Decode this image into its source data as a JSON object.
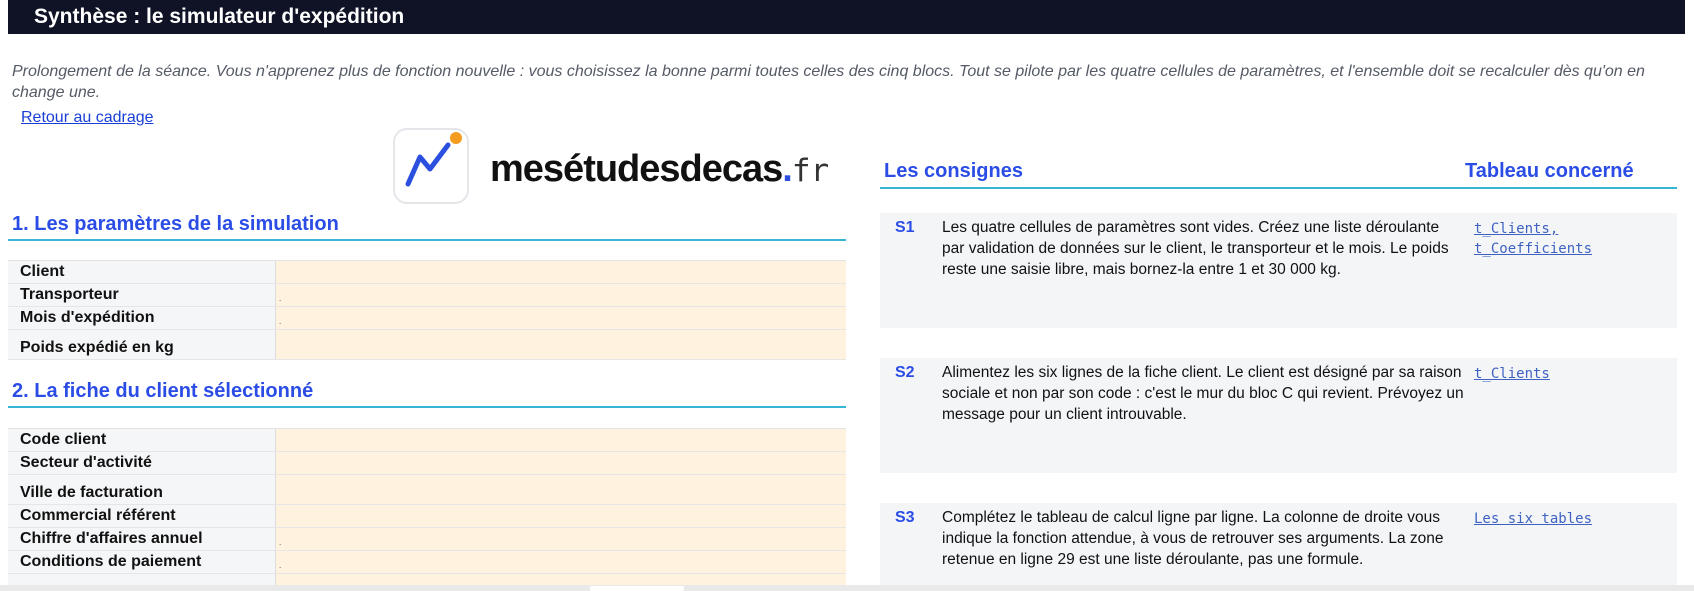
{
  "header": {
    "title": "Synthèse : le simulateur d'expédition"
  },
  "intro": {
    "text": "Prolongement de la séance. Vous n'apprenez plus de fonction nouvelle : vous choisissez la bonne parmi toutes celles des cinq blocs. Tout se pilote par les quatre cellules de paramètres, et l'ensemble doit se recalculer dès qu'on en change une.",
    "back_link": "Retour au cadrage"
  },
  "logo": {
    "brand": "mesétudesdecas",
    "dot": ".",
    "tld": "fr",
    "colors": {
      "mark": "#2b50e0",
      "accent": "#f39c1f"
    }
  },
  "section1": {
    "title": "1. Les paramètres de la simulation",
    "rows": [
      {
        "label": "Client",
        "value": "",
        "tick": ""
      },
      {
        "label": "Transporteur",
        "value": "",
        "tick": "."
      },
      {
        "label": "Mois d'expédition",
        "value": "",
        "tick": "."
      },
      {
        "label": "Poids expédié en kg",
        "value": "",
        "tick": ""
      }
    ]
  },
  "section2": {
    "title": "2. La fiche du client sélectionné",
    "rows": [
      {
        "label": "Code client",
        "value": "",
        "tick": ""
      },
      {
        "label": "Secteur d'activité",
        "value": "",
        "tick": ""
      },
      {
        "label": "Ville de facturation",
        "value": "",
        "tick": ""
      },
      {
        "label": "Commercial référent",
        "value": "",
        "tick": ""
      },
      {
        "label": "Chiffre d'affaires annuel",
        "value": "",
        "tick": "."
      },
      {
        "label": "Conditions de paiement",
        "value": "",
        "tick": "."
      }
    ]
  },
  "consignes": {
    "header": "Les consignes",
    "table_header": "Tableau concerné",
    "steps": [
      {
        "id": "S1",
        "text": "Les quatre cellules de paramètres sont vides. Créez une liste déroulante par validation de données sur le client, le transporteur et le mois. Le poids reste une saisie libre, mais bornez-la entre 1 et 30 000 kg.",
        "refs": [
          "t_Clients,",
          "t_Coefficients"
        ]
      },
      {
        "id": "S2",
        "text": "Alimentez les six lignes de la fiche client. Le client est désigné par sa raison sociale et non par son code : c'est le mur du bloc C qui revient. Prévoyez un message pour un client introuvable.",
        "refs": [
          "t_Clients"
        ]
      },
      {
        "id": "S3",
        "text": "Complétez le tableau de calcul ligne par ligne. La colonne de droite vous indique la fonction attendue, à vous de retrouver ses arguments. La zone retenue en ligne 29 est une liste déroulante, pas une formule.",
        "refs": [
          "Les six tables"
        ]
      }
    ]
  },
  "colors": {
    "banner_bg": "#0f1325",
    "heading_blue": "#2b4de6",
    "rule_cyan": "#36b5d4",
    "input_fill": "#fff3df",
    "label_fill": "#f5f6f8",
    "step_fill": "#f3f5f7"
  }
}
